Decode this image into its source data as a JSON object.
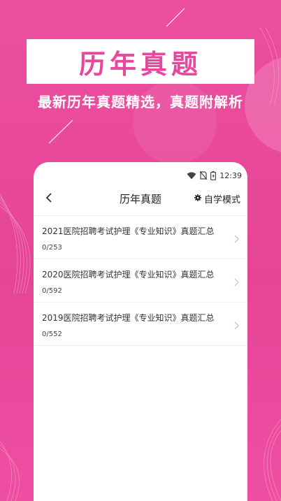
{
  "banner": {
    "title": "历年真题",
    "subtitle": "最新历年真题精选，真题附解析"
  },
  "status_bar": {
    "time": "12:39",
    "icons": [
      "wifi-icon",
      "no-sim-icon",
      "battery-icon"
    ]
  },
  "nav": {
    "back_icon": "chevron-left-icon",
    "title": "历年真题",
    "mode_icon": "gear-icon",
    "mode_label": "自学模式"
  },
  "items": [
    {
      "title": "2021医院招聘考试护理《专业知识》真题汇总",
      "progress": "0/253"
    },
    {
      "title": "2020医院招聘考试护理《专业知识》真题汇总",
      "progress": "0/592"
    },
    {
      "title": "2019医院招聘考试护理《专业知识》真题汇总",
      "progress": "0/552"
    }
  ],
  "colors": {
    "brand_pink": "#e8489b",
    "background": "#ec4fa0"
  }
}
